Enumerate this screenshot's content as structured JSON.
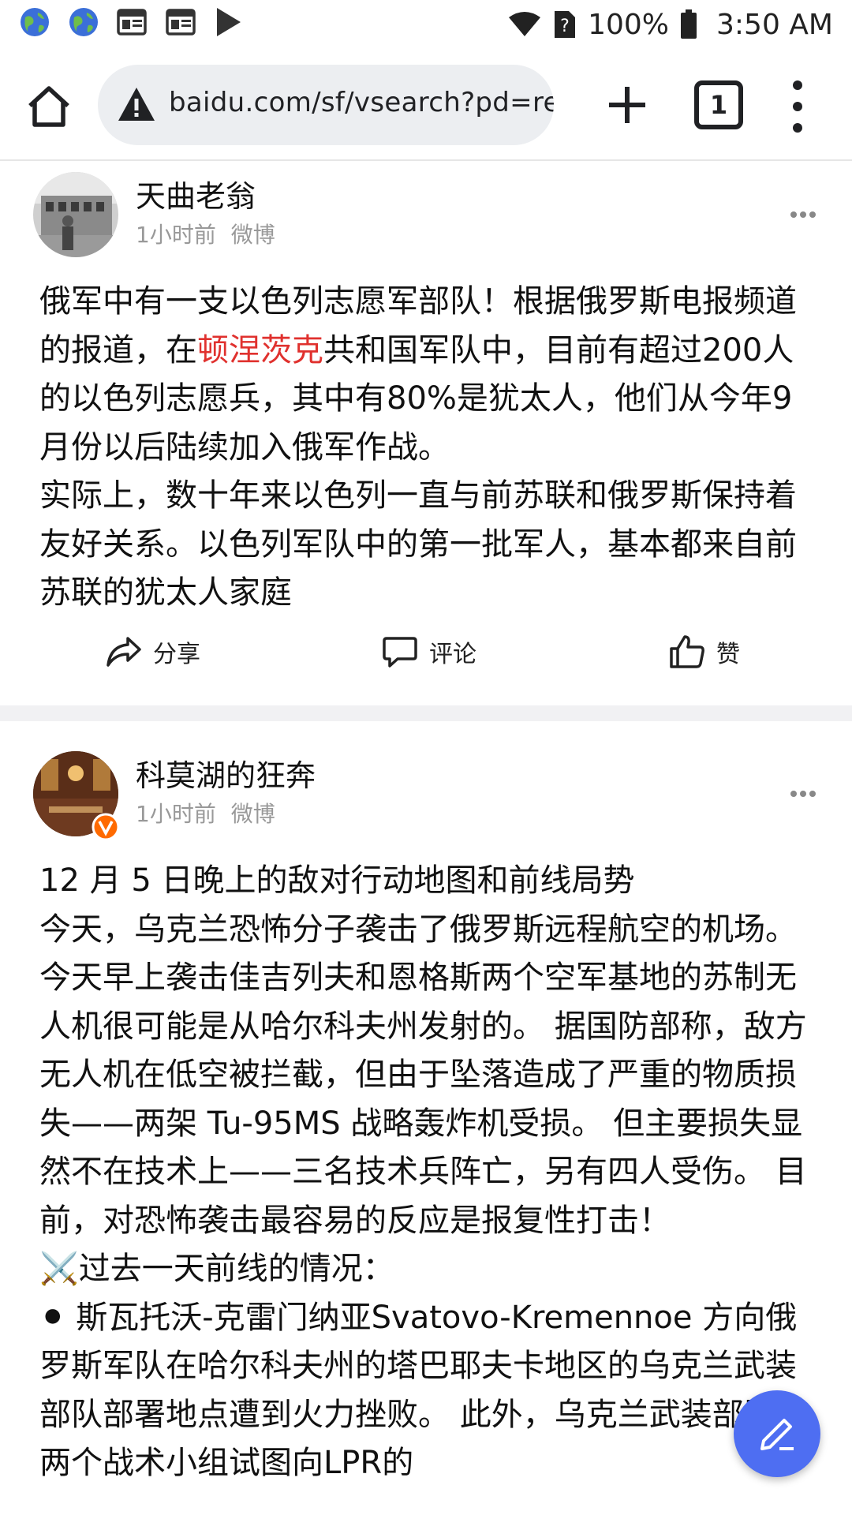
{
  "status_bar": {
    "left_icons": [
      "globe-icon",
      "globe-icon",
      "news-icon",
      "news-icon",
      "play-store-icon"
    ],
    "battery": "100%",
    "time": "3:50 AM"
  },
  "browser": {
    "url": "baidu.com/sf/vsearch?pd=rea",
    "tab_count": "1"
  },
  "posts": [
    {
      "author": "天曲老翁",
      "time": "1小时前",
      "source": "微博",
      "text_before": "俄军中有一支以色列志愿军部队！根据俄罗斯电报频道的报道，在",
      "highlight": "顿涅茨克",
      "text_after": "共和国军队中，目前有超过200人的以色列志愿兵，其中有80%是犹太人，他们从今年9月份以后陆续加入俄军作战。",
      "paragraph2": "实际上，数十年来以色列一直与前苏联和俄罗斯保持着友好关系。以色列军队中的第一批军人，基本都来自前苏联的犹太人家庭"
    },
    {
      "author": "科莫湖的狂奔",
      "time": "1小时前",
      "source": "微博",
      "line1": "12 月 5 日晚上的敌对行动地图和前线局势",
      "paragraph": "今天，乌克兰恐怖分子袭击了俄罗斯远程航空的机场。 今天早上袭击佳吉列夫和恩格斯两个空军基地的苏制无人机很可能是从哈尔科夫州发射的。 据国防部称，敌方无人机在低空被拦截，但由于坠落造成了严重的物质损失——两架 Tu-95MS 战略轰炸机受损。 但主要损失显然不在技术上——三名技术兵阵亡，另有四人受伤。 目前，对恐怖袭击最容易的反应是报复性打击！",
      "front_heading": "⚔️过去一天前线的情况：",
      "front_text": "⚫ 斯瓦托沃-克雷门纳亚Svatovo-Kremennoe 方向俄罗斯军队在哈尔科夫州的塔巴耶夫卡地区的乌克兰武装部队部署地点遭到火力挫败。 此外，乌克兰武装部队的两个战术小组试图向LPR的"
    }
  ],
  "actions": {
    "share": "分享",
    "comment": "评论",
    "like": "赞"
  },
  "colors": {
    "highlight": "#e0312e",
    "fab": "#4e6ef2",
    "meta": "#999999"
  }
}
